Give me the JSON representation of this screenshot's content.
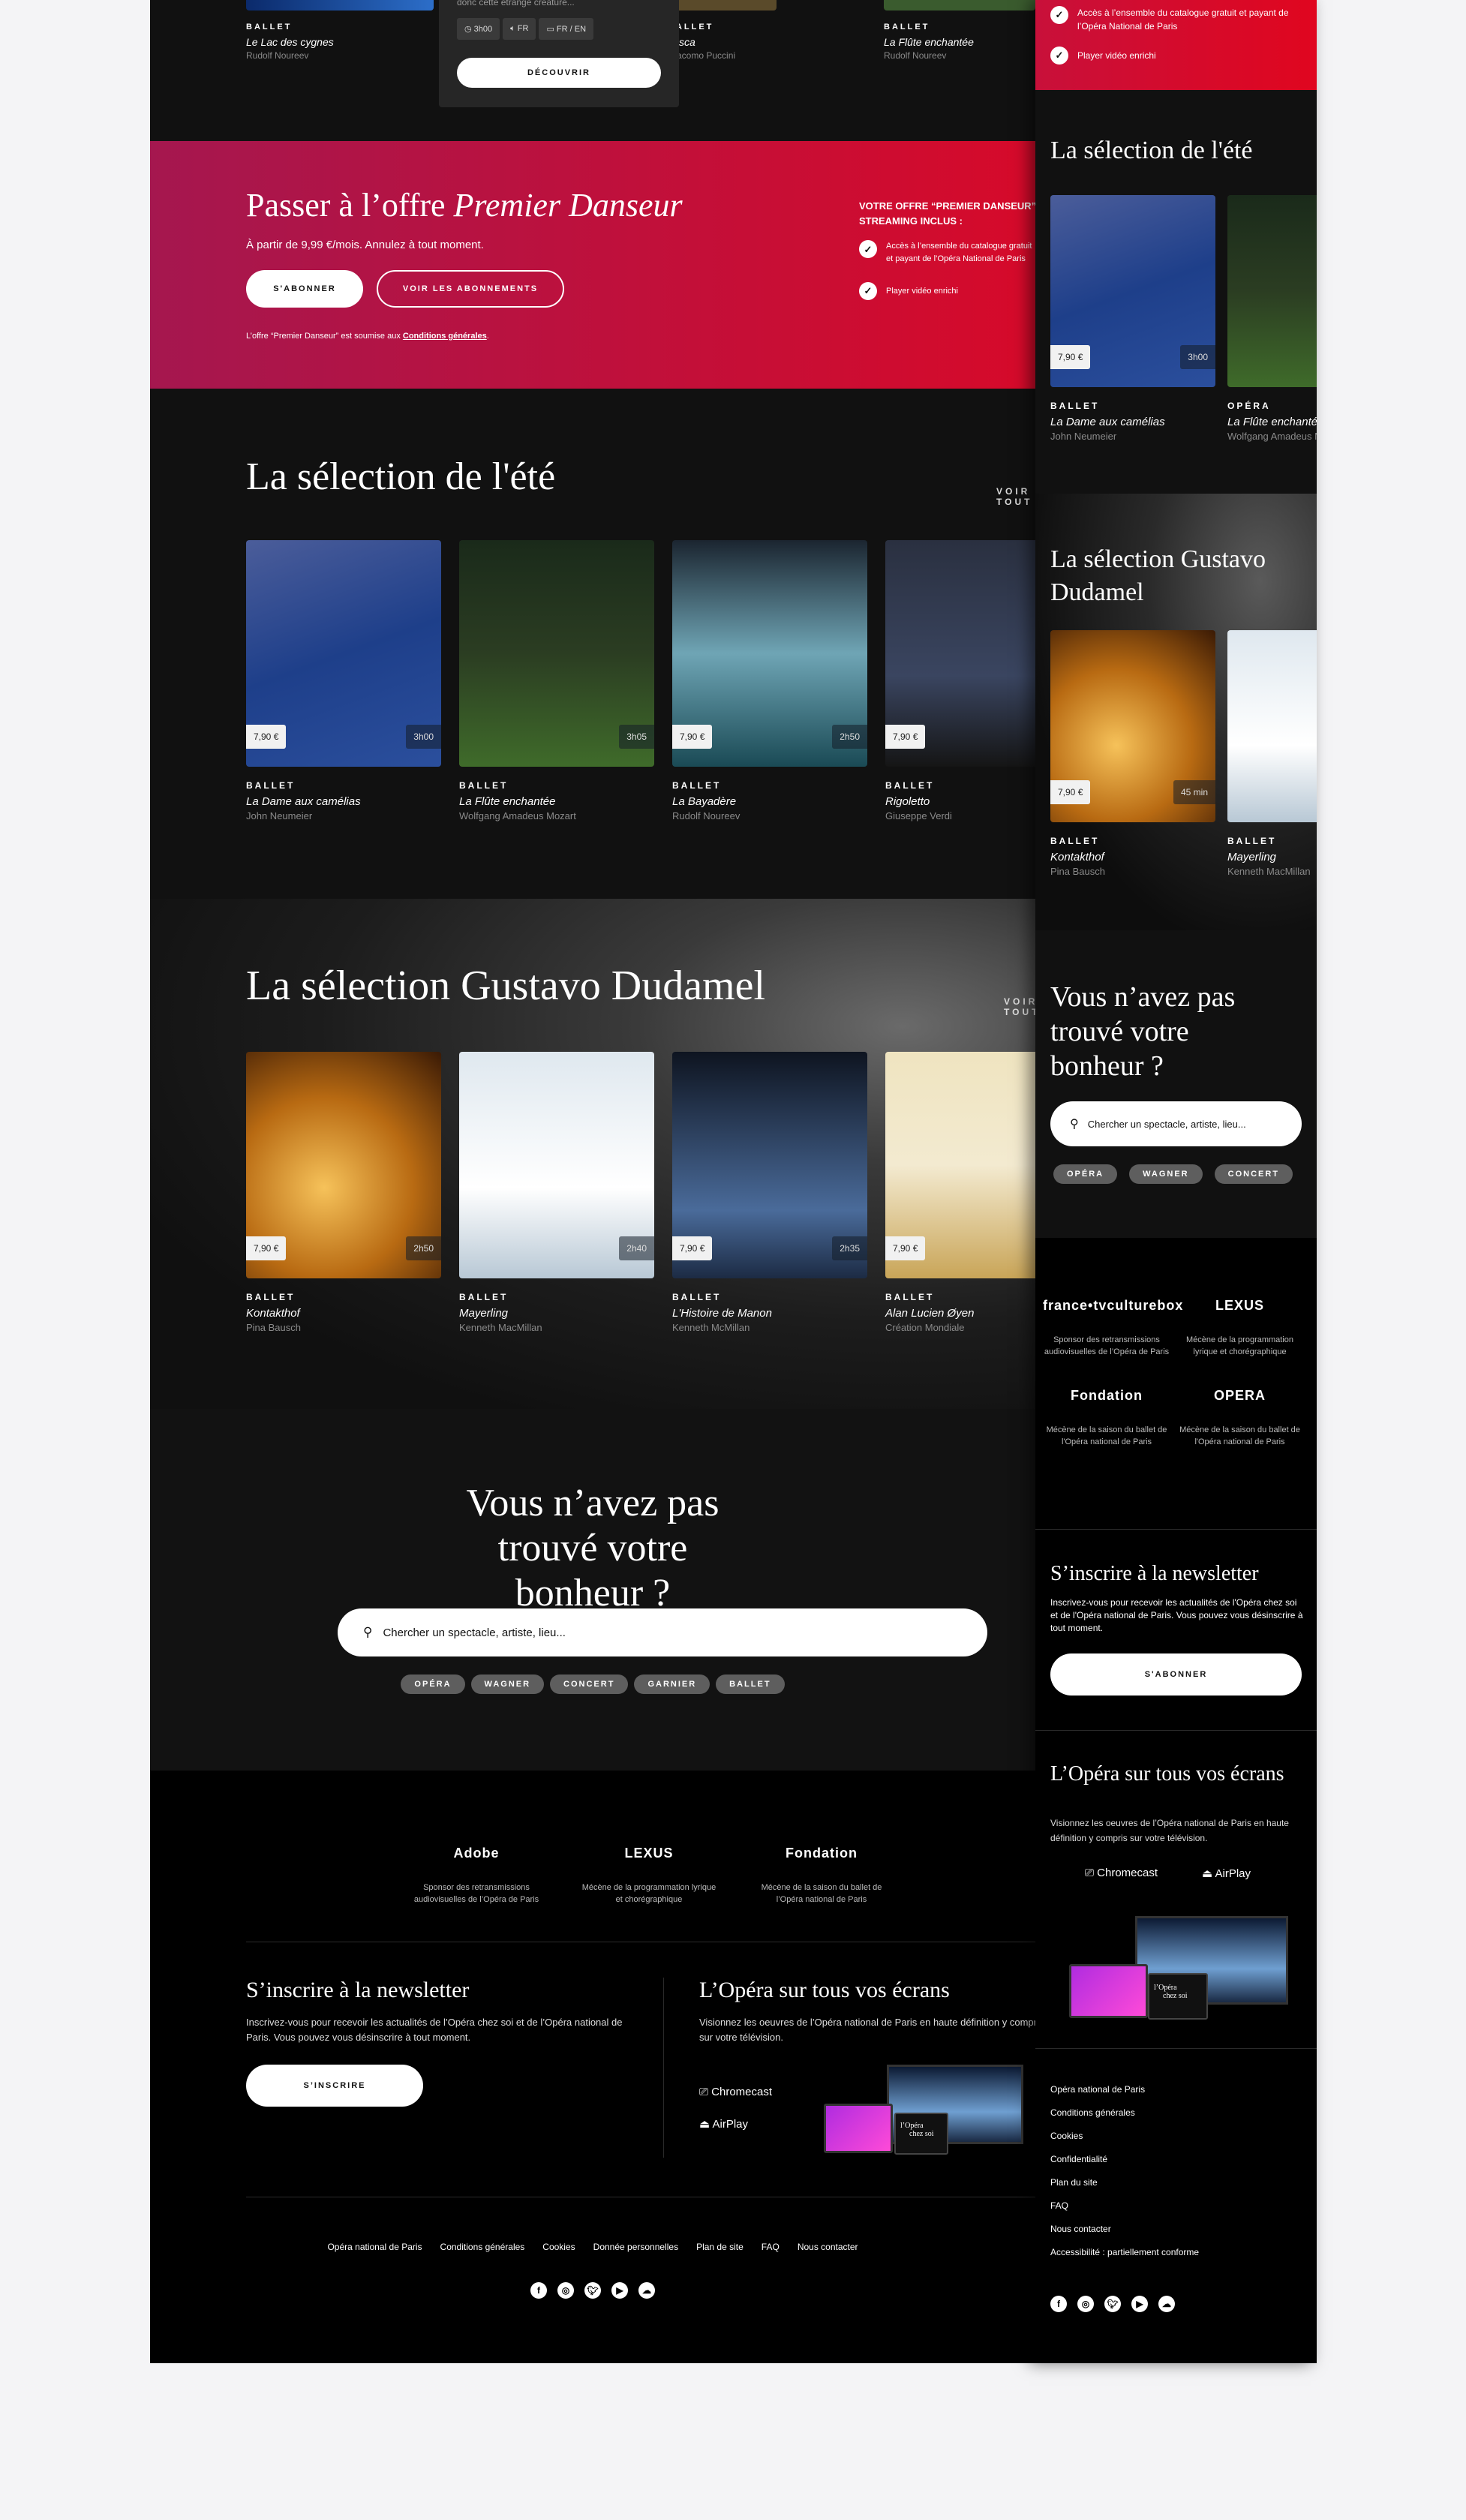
{
  "top_row": {
    "cards": [
      {
        "category": "BALLET",
        "title": "Le Lac des cygnes",
        "author": "Rudolf Noureev"
      },
      {
        "category": "BALLET",
        "title": "Tosca",
        "author": "Giacomo Puccini"
      },
      {
        "category": "BALLET",
        "title": "La Flûte enchantée",
        "author": "Rudolf Noureev"
      }
    ],
    "popover": {
      "excerpt": "donc cette étrange créature...",
      "duration": "3h00",
      "audio": "FR",
      "subtitles": "FR / EN",
      "cta": "DÉCOUVRIR"
    }
  },
  "offer": {
    "title_plain": "Passer à l’offre ",
    "title_italic": "Premier Danseur",
    "subtitle": "À partir de 9,99 €/mois. Annulez à tout moment.",
    "subscribe": "S'ABONNER",
    "see_plans": "VOIR LES ABONNEMENTS",
    "legal_prefix": "L’offre “Premier Danseur” est soumise aux ",
    "legal_link": "Conditions générales",
    "legal_suffix": ".",
    "includes_title": "VOTRE OFFRE “PREMIER DANSEUR” STREAMING INCLUS :",
    "benefits": [
      "Accès à l’ensemble du catalogue gratuit et payant de l’Opéra National de Paris",
      "Player vidéo enrichi"
    ],
    "colors": {
      "start": "#a5174f",
      "end": "#d60a2a"
    }
  },
  "summer": {
    "title": "La sélection de l'été",
    "see_all": "VOIR TOUT",
    "cards": [
      {
        "category": "BALLET",
        "title": "La Dame aux camélias",
        "author": "John Neumeier",
        "price": "7,90 €",
        "duration": "3h00"
      },
      {
        "category": "BALLET",
        "title": "La Flûte enchantée",
        "author": "Wolfgang Amadeus Mozart",
        "price": "",
        "duration": "3h05"
      },
      {
        "category": "BALLET",
        "title": "La Bayadère",
        "author": "Rudolf Noureev",
        "price": "7,90 €",
        "duration": "2h50"
      },
      {
        "category": "BALLET",
        "title": "Rigoletto",
        "author": "Giuseppe Verdi",
        "price": "7,90 €",
        "duration": ""
      }
    ]
  },
  "dudamel": {
    "title": "La sélection Gustavo Dudamel",
    "see_all": "VOIR TOUT",
    "cards": [
      {
        "category": "BALLET",
        "title": "Kontakthof",
        "author": "Pina Bausch",
        "price": "7,90 €",
        "duration": "2h50"
      },
      {
        "category": "BALLET",
        "title": "Mayerling",
        "author": "Kenneth MacMillan",
        "price": "",
        "duration": "2h40"
      },
      {
        "category": "BALLET",
        "title": "L'Histoire de Manon",
        "author": "Kenneth McMillan",
        "price": "7,90 €",
        "duration": "2h35"
      },
      {
        "category": "BALLET",
        "title": "Alan Lucien Øyen",
        "author": "Création Mondiale",
        "price": "7,90 €",
        "duration": ""
      }
    ]
  },
  "search": {
    "title": "Vous n’avez pas trouvé votre bonheur ?",
    "placeholder": "Chercher un spectacle, artiste, lieu...",
    "tags": [
      "OPÉRA",
      "WAGNER",
      "CONCERT",
      "GARNIER",
      "BALLET"
    ]
  },
  "sponsors": [
    {
      "logo": "Adobe",
      "text": "Sponsor des retransmissions audiovisuelles de l’Opéra de Paris"
    },
    {
      "logo": "LEXUS",
      "text": "Mécène de la programmation lyrique et chorégraphique"
    },
    {
      "logo": "Fondation",
      "text": "Mécène de la saison du ballet de l’Opéra national de Paris"
    }
  ],
  "newsletter": {
    "title": "S’inscrire à la newsletter",
    "text": "Inscrivez-vous pour recevoir les actualités de l’Opéra chez soi et de l’Opéra national de Paris. Vous pouvez vous désinscrire à tout moment.",
    "cta": "S’INSCRIRE"
  },
  "screens": {
    "title": "L’Opéra sur tous vos écrans",
    "text": "Visionnez les oeuvres de l’Opéra national de Paris en haute définition y compris sur votre télévision.",
    "chromecast": "Chromecast",
    "airplay": "AirPlay",
    "brand_line1": "l’Opéra",
    "brand_line2": "chez soi"
  },
  "footer": {
    "links": [
      "Opéra national de Paris",
      "Conditions générales",
      "Cookies",
      "Donnée personnelles",
      "Plan de site",
      "FAQ",
      "Nous contacter"
    ],
    "social": [
      "facebook",
      "instagram",
      "twitter",
      "youtube",
      "soundcloud"
    ]
  },
  "mobile": {
    "benefits": [
      "Accès à l’ensemble du catalogue gratuit et payant de l’Opéra National de Paris",
      "Player vidéo enrichi"
    ],
    "summer_title": "La sélection de l'été",
    "summer_cards": [
      {
        "category": "BALLET",
        "title": "La Dame aux camélias",
        "author": "John Neumeier",
        "price": "7,90 €",
        "duration": "3h00"
      },
      {
        "category": "OPÉRA",
        "title": "La Flûte enchantée",
        "author": "Wolfgang Amadeus Mozart"
      }
    ],
    "dudamel_title": "La sélection Gustavo Dudamel",
    "dudamel_cards": [
      {
        "category": "BALLET",
        "title": "Kontakthof",
        "author": "Pina Bausch",
        "price": "7,90 €",
        "duration": "45 min"
      },
      {
        "category": "BALLET",
        "title": "Mayerling",
        "author": "Kenneth MacMillan"
      }
    ],
    "search_title": "Vous n’avez pas trouvé votre bonheur ?",
    "search_placeholder": "Chercher un spectacle, artiste, lieu...",
    "tags": [
      "OPÉRA",
      "WAGNER",
      "CONCERT"
    ],
    "sponsors": [
      {
        "logo": "france•tvculturebox",
        "text": "Sponsor des retransmissions audiovisuelles de l’Opéra de Paris"
      },
      {
        "logo": "LEXUS",
        "text": "Mécène de la programmation lyrique et chorégraphique"
      },
      {
        "logo": "Fondation",
        "text": "Mécène de la saison du ballet de l'Opéra national de Paris"
      },
      {
        "logo": "OPERA",
        "text": "Mécène de la saison du ballet de l'Opéra national de Paris"
      }
    ],
    "newsletter_title": "S’inscrire à la newsletter",
    "newsletter_text": "Inscrivez-vous pour recevoir les actualités de l'Opéra chez soi et de l'Opéra national de Paris. Vous pouvez vous désinscrire à tout moment.",
    "newsletter_cta": "S'ABONNER",
    "screens_title": "L’Opéra sur tous vos écrans",
    "screens_text": "Visionnez les oeuvres de l’Opéra national de Paris en haute définition y compris sur votre télévision.",
    "footer_links": [
      "Opéra national de Paris",
      "Conditions générales",
      "Cookies",
      "Confidentialité",
      "Plan du site",
      "FAQ",
      "Nous contacter",
      "Accessibilité : partiellement conforme"
    ]
  }
}
